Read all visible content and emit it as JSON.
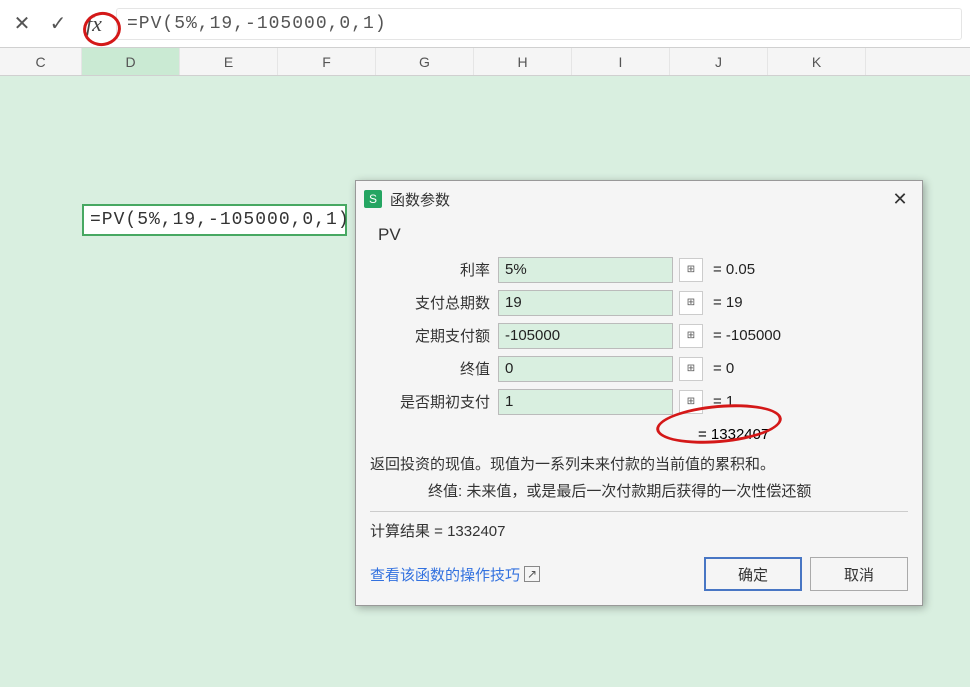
{
  "formula_bar": {
    "formula": "=PV(5%,19,-105000,0,1)"
  },
  "columns": [
    "C",
    "D",
    "E",
    "F",
    "G",
    "H",
    "I",
    "J",
    "K"
  ],
  "active_column": "D",
  "cell_formula": "=PV(5%,19,-105000,0,1)",
  "dialog": {
    "title": "函数参数",
    "function_name": "PV",
    "params": [
      {
        "label": "利率",
        "value": "5%",
        "result": "= 0.05"
      },
      {
        "label": "支付总期数",
        "value": "19",
        "result": "= 19"
      },
      {
        "label": "定期支付额",
        "value": "-105000",
        "result": "= -105000"
      },
      {
        "label": "终值",
        "value": "0",
        "result": "= 0"
      },
      {
        "label": "是否期初支付",
        "value": "1",
        "result": "= 1"
      }
    ],
    "interim_result": "= 1332407",
    "description": "返回投资的现值。现值为一系列未来付款的当前值的累积和。",
    "param_desc": "终值: 未来值，或是最后一次付款期后获得的一次性偿还额",
    "calc_label": "计算结果 = 1332407",
    "help_link": "查看该函数的操作技巧",
    "ok_button": "确定",
    "cancel_button": "取消"
  }
}
